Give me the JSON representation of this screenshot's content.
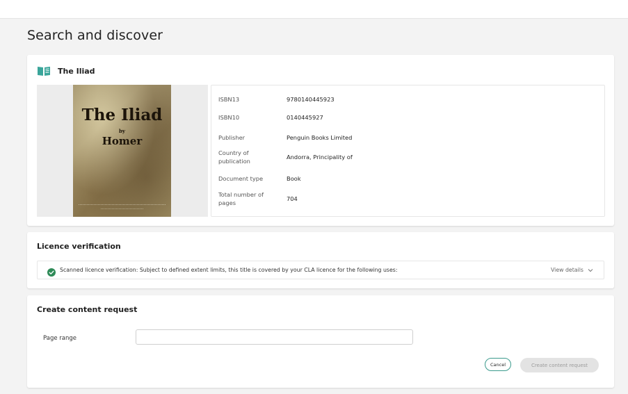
{
  "page": {
    "title": "Search and discover"
  },
  "book": {
    "title": "The Iliad",
    "cover": {
      "title": "The Iliad",
      "by": "by",
      "author": "Homer"
    },
    "details": [
      {
        "label": "ISBN13",
        "value": "9780140445923"
      },
      {
        "label": "ISBN10",
        "value": "0140445927"
      },
      {
        "label": "Publisher",
        "value": "Penguin Books Limited"
      },
      {
        "label": "Country of publication",
        "value": "Andorra, Principality of"
      },
      {
        "label": "Document type",
        "value": "Book"
      },
      {
        "label": "Total number of pages",
        "value": "704"
      }
    ]
  },
  "licence": {
    "title": "Licence verification",
    "message": "Scanned licence verification: Subject to defined extent limits, this title is covered by your CLA licence for the following uses:",
    "view_details": "View details"
  },
  "request": {
    "title": "Create content request",
    "page_range_label": "Page range",
    "page_range_value": "",
    "cancel_label": "Cancel",
    "create_label": "Create content request"
  },
  "colors": {
    "accent": "#3a9a8c",
    "check": "#2e8a57",
    "book_icon": "#3aa59a"
  }
}
